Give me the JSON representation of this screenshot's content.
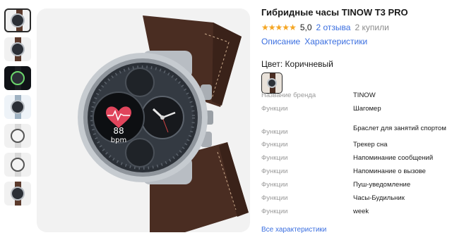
{
  "product": {
    "title": "Гибридные часы TINOW T3 PRO",
    "rating": {
      "stars": 5,
      "score": "5,0",
      "reviews_label": "2 отзыва",
      "bought_label": "2 купили"
    },
    "tabs": [
      "Описание",
      "Характеристики"
    ],
    "color": {
      "label": "Цвет: Коричневый",
      "selected_swatch": "brown-leather-watch"
    }
  },
  "watch_face": {
    "heart_rate_value": "88",
    "heart_rate_unit": "bpm"
  },
  "specs": [
    {
      "key": "Название бренда",
      "value": "TINOW"
    },
    {
      "key": "Функции",
      "value": "Шагомер"
    },
    {
      "key": "Функции",
      "value": "Браслет для занятий спортом"
    },
    {
      "key": "Функции",
      "value": "Трекер сна"
    },
    {
      "key": "Функции",
      "value": "Напоминание сообщений"
    },
    {
      "key": "Функции",
      "value": "Напоминание о вызове"
    },
    {
      "key": "Функции",
      "value": "Пуш-уведомление"
    },
    {
      "key": "Функции",
      "value": "Часы-Будильник"
    },
    {
      "key": "Функции",
      "value": "week"
    }
  ],
  "all_specs_link": "Все характеристики",
  "colors": {
    "link": "#3b6fe0",
    "star": "#f5a623",
    "muted": "#9a9a9a",
    "strap": "#4a2d22"
  }
}
